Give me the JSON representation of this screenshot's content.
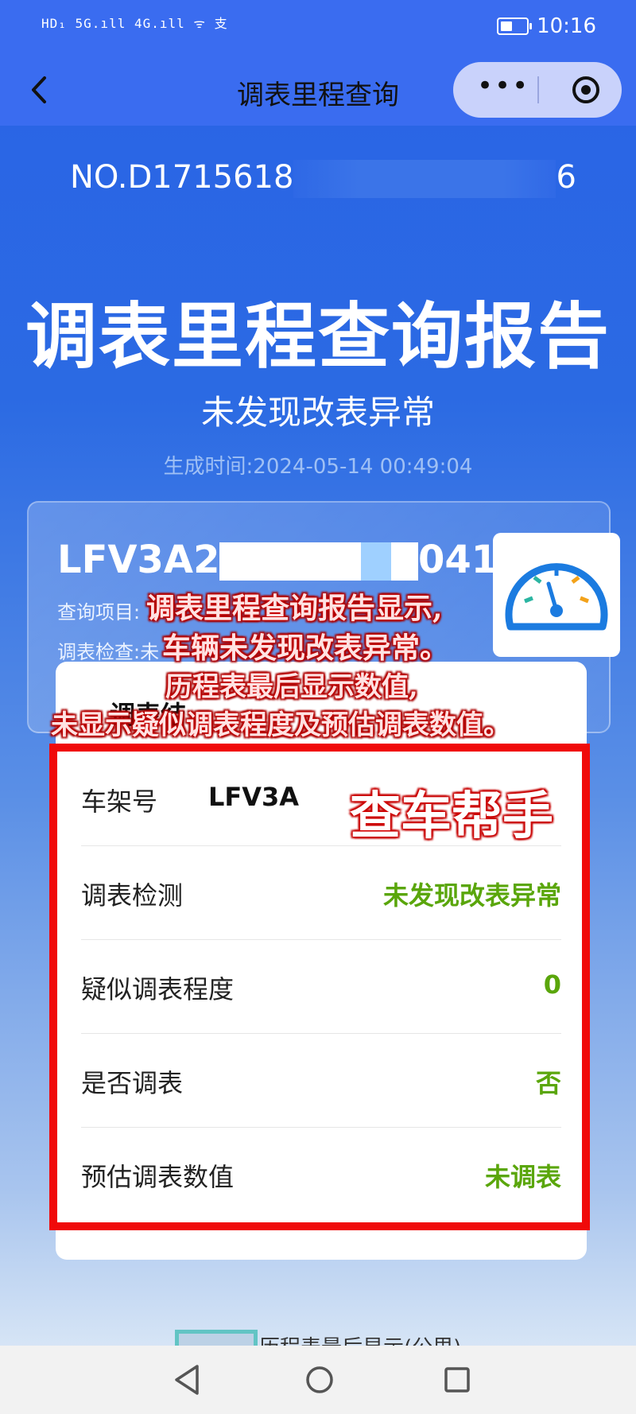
{
  "status_bar": {
    "left_indicators": "HD₁ 5G.ıll 4G.ıll ᯤ 支",
    "time": "10:16"
  },
  "nav": {
    "title": "调表里程查询",
    "more_label": "•••",
    "back_label": "‹"
  },
  "report": {
    "number_prefix": "NO.D1715618",
    "number_suffix": "6",
    "title": "调表里程查询报告",
    "subtitle": "未发现改表异常",
    "generated": "生成时间:2024-05-14 00:49:04"
  },
  "vin_card": {
    "vin_start": "LFV3A24",
    "vin_end": "041",
    "line1": "查询项目:",
    "line2": "调表检查:未"
  },
  "detail": {
    "heading": "调表结",
    "rows": [
      {
        "label": "车架号",
        "value": "LFV3A"
      },
      {
        "label": "调表检测",
        "value": "未发现改表异常"
      },
      {
        "label": "疑似调表程度",
        "value": "0"
      },
      {
        "label": "是否调表",
        "value": "否"
      },
      {
        "label": "预估调表数值",
        "value": "未调表"
      }
    ]
  },
  "overlay": {
    "line1": "调表里程查询报告显示,",
    "line2": "车辆未发现改表异常。",
    "line3": "历程表最后显示数值,",
    "line4": "未显示疑似调表程度及预估调表数值。",
    "watermark": "查车帮手"
  },
  "footer": {
    "peek_text": "历程表最后显示(公里)"
  },
  "colors": {
    "brand_blue": "#3a6cf0",
    "status_green": "#5aa60b",
    "highlight_red": "#f00a0a"
  }
}
